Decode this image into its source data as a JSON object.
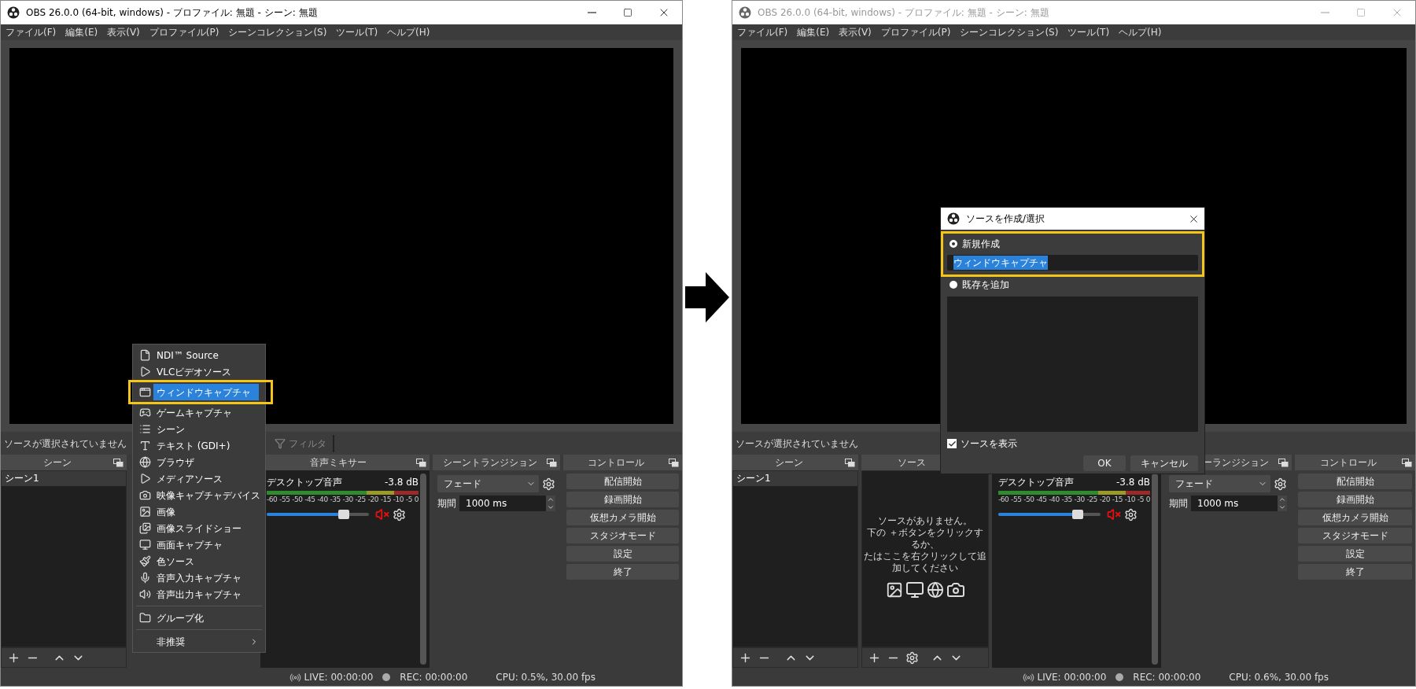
{
  "windows": [
    {
      "title": "OBS 26.0.0 (64-bit, windows) - プロファイル: 無題 - シーン: 無題",
      "active": true,
      "menu": [
        "ファイル(F)",
        "編集(E)",
        "表示(V)",
        "プロファイル(P)",
        "シーンコレクション(S)",
        "ツール(T)",
        "ヘルプ(H)"
      ],
      "source_toolbar": {
        "status": "ソースが選択されていません",
        "buttons": [
          {
            "label": "フィルタ",
            "disabled": true
          }
        ]
      },
      "scenes": {
        "title": "シーン",
        "items": [
          {
            "label": "シーン1",
            "selected": true
          }
        ]
      },
      "mixer": {
        "title": "音声ミキサー",
        "channels": [
          {
            "name": "デスクトップ音声",
            "reading": "-3.8 dB",
            "scale": [
              "-60",
              "-55",
              "-50",
              "-45",
              "-40",
              "-35",
              "-30",
              "-25",
              "-20",
              "-15",
              "-10",
              "-5",
              "0"
            ],
            "level": 0.75,
            "muted": true
          }
        ]
      },
      "transitions": {
        "title": "シーントランジション",
        "clipped": false,
        "transition": "フェード",
        "duration_label": "期間",
        "duration": "1000 ms"
      },
      "controls": {
        "title": "コントロール",
        "buttons": [
          "配信開始",
          "録画開始",
          "仮想カメラ開始",
          "スタジオモード",
          "設定",
          "終了"
        ]
      },
      "status_bar": {
        "live": "LIVE: 00:00:00",
        "rec": "REC: 00:00:00",
        "cpu": "CPU: 0.5%, 30.00 fps"
      },
      "context_menu": {
        "items": [
          {
            "kind": "item",
            "label": "NDI™ Source",
            "selected": false
          },
          {
            "kind": "item",
            "label": "VLCビデオソース",
            "selected": false
          },
          {
            "kind": "item",
            "label": "ウィンドウキャプチャ",
            "selected": true,
            "framed": true
          },
          {
            "kind": "item",
            "label": "ゲームキャプチャ",
            "selected": false
          },
          {
            "kind": "item",
            "label": "シーン",
            "selected": false
          },
          {
            "kind": "item",
            "label": "テキスト (GDI+)",
            "selected": false
          },
          {
            "kind": "item",
            "label": "ブラウザ",
            "selected": false
          },
          {
            "kind": "item",
            "label": "メディアソース",
            "selected": false
          },
          {
            "kind": "item",
            "label": "映像キャプチャデバイス",
            "selected": false
          },
          {
            "kind": "item",
            "label": "画像",
            "selected": false
          },
          {
            "kind": "item",
            "label": "画像スライドショー",
            "selected": false
          },
          {
            "kind": "item",
            "label": "画面キャプチャ",
            "selected": false
          },
          {
            "kind": "item",
            "label": "色ソース",
            "selected": false
          },
          {
            "kind": "item",
            "label": "音声入力キャプチャ",
            "selected": false
          },
          {
            "kind": "item",
            "label": "音声出力キャプチャ",
            "selected": false
          },
          {
            "kind": "separator"
          },
          {
            "kind": "item",
            "label": "グループ化",
            "selected": false
          },
          {
            "kind": "separator"
          },
          {
            "kind": "submenu",
            "label": "非推奨",
            "selected": false
          }
        ]
      }
    },
    {
      "title": "OBS 26.0.0 (64-bit, windows) - プロファイル: 無題 - シーン: 無題",
      "active": false,
      "menu": [
        "ファイル(F)",
        "編集(E)",
        "表示(V)",
        "プロファイル(P)",
        "シーンコレクション(S)",
        "ツール(T)",
        "ヘルプ(H)"
      ],
      "source_toolbar": {
        "status": "ソースが選択されていません"
      },
      "scenes": {
        "title": "シーン",
        "items": [
          {
            "label": "シーン1",
            "selected": true
          }
        ]
      },
      "sources": {
        "title": "ソース",
        "float_button": false,
        "empty_message": [
          "ソースがありません。",
          "下の ＋ボタンをクリックするか、",
          "たはここを右クリックして追加してください"
        ]
      },
      "mixer": {
        "channels": [
          {
            "name": "デスクトップ音声",
            "reading": "-3.8 dB",
            "scale": [
              "-60",
              "-55",
              "-50",
              "-45",
              "-40",
              "-35",
              "-30",
              "-25",
              "-20",
              "-15",
              "-10",
              "-5",
              "0"
            ],
            "level": 0.78,
            "muted": true
          }
        ]
      },
      "transitions": {
        "title": "ーランジション",
        "clipped": true,
        "transition": "フェード",
        "duration_label": "期間",
        "duration": "1000 ms"
      },
      "controls": {
        "title": "コントロール",
        "buttons": [
          "配信開始",
          "録画開始",
          "仮想カメラ開始",
          "スタジオモード",
          "設定",
          "終了"
        ]
      },
      "status_bar": {
        "live": "LIVE: 00:00:00",
        "rec": "REC: 00:00:00",
        "cpu": "CPU: 0.6%, 30.00 fps"
      },
      "dialog": {
        "title": "ソースを作成/選択",
        "framed": true,
        "options": [
          {
            "label": "新規作成",
            "selected": true
          },
          {
            "label": "既存を追加",
            "selected": false
          }
        ],
        "name_value": "ウィンドウキャプチャ",
        "show_source": {
          "label": "ソースを表示",
          "checked": true
        },
        "buttons": [
          "OK",
          "キャンセル"
        ]
      }
    }
  ]
}
